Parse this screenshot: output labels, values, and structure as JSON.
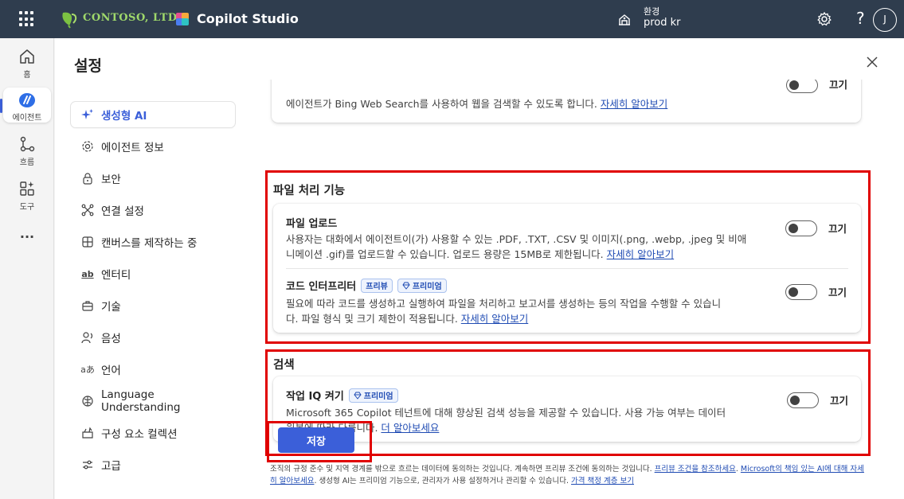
{
  "topbar": {
    "brand": "CONTOSO, LTD.",
    "app_title": "Copilot Studio",
    "env_label": "환경",
    "env_value": "prod kr",
    "avatar_initial": "J"
  },
  "rail": {
    "items": [
      {
        "label": "홈",
        "icon": "home-icon"
      },
      {
        "label": "에이전트",
        "icon": "agent-icon"
      },
      {
        "label": "흐름",
        "icon": "flow-icon"
      },
      {
        "label": "도구",
        "icon": "tools-icon"
      }
    ],
    "more": "···"
  },
  "panel": {
    "title": "설정"
  },
  "settings_nav": {
    "items": [
      {
        "label": "생성형 AI",
        "icon": "sparkle-icon"
      },
      {
        "label": "에이전트 정보",
        "icon": "gear-icon"
      },
      {
        "label": "보안",
        "icon": "lock-icon"
      },
      {
        "label": "연결 설정",
        "icon": "connection-icon"
      },
      {
        "label": "캔버스를 제작하는 중",
        "icon": "canvas-icon"
      },
      {
        "label": "엔터티",
        "icon": "entity-icon"
      },
      {
        "label": "기술",
        "icon": "briefcase-icon"
      },
      {
        "label": "음성",
        "icon": "voice-icon"
      },
      {
        "label": "언어",
        "icon": "language-icon"
      },
      {
        "label": "Language Understanding",
        "icon": "brain-icon"
      },
      {
        "label": "구성 요소 컬렉션",
        "icon": "collection-icon"
      },
      {
        "label": "고급",
        "icon": "sliders-icon"
      }
    ]
  },
  "content": {
    "top_card": {
      "desc": "에이전트가 Bing Web Search를 사용하여 웹을 검색할 수 있도록 합니다.",
      "link": "자세히 알아보기",
      "toggle_label": "끄기"
    },
    "file_section": {
      "heading": "파일 처리 기능",
      "upload": {
        "title": "파일 업로드",
        "desc_line1": "사용자는 대화에서 에이전트이(가) 사용할 수 있는 .PDF, .TXT, .CSV 및 이미지(.png, .webp, .jpeg 및 비애",
        "desc_line2": "니메이션 .gif)를 업로드할 수 있습니다. 업로드 용량은 15MB로 제한됩니다.",
        "link": "자세히 알아보기",
        "toggle_label": "끄기"
      },
      "interpreter": {
        "title": "코드 인터프리터",
        "badge_preview": "프리뷰",
        "badge_premium": "프리미엄",
        "desc_line1": "필요에 따라 코드를 생성하고 실행하여 파일을 처리하고 보고서를 생성하는 등의 작업을 수행할 수 있습니",
        "desc_line2": "다. 파일 형식 및 크기 제한이 적용됩니다.",
        "link": "자세히 알아보기",
        "toggle_label": "끄기"
      }
    },
    "search_section": {
      "heading": "검색",
      "work_iq": {
        "title": "작업 IQ 켜기",
        "badge_premium": "프리미엄",
        "desc_line1": "Microsoft 365 Copilot 테넌트에 대해 향상된 검색 성능을 제공할 수 있습니다. 사용 가능 여부는 데이터",
        "desc_line2": "원본에 따라 다릅니다.",
        "link": "더 알아보세요",
        "toggle_label": "끄기"
      }
    },
    "save_label": "저장",
    "footer": {
      "text1": "조직의 규정 준수 및 지역 경계를 밖으로 흐르는 데이터에 동의하는 것입니다. 계속하면 프리뷰 조건에 동의하는 것입니다.",
      "link1": "프리뷰 조건을 참조하세요",
      "link2": "Microsoft의 책임 있는 AI에 대해 자세히 알아보세요",
      "text2": "생성형 AI는 프리미엄 기능으로, 관리자가 사용 설정하거나 관리할 수 있습니다.",
      "link3": "가격 책정 계층 보기"
    }
  },
  "colors": {
    "topbar": "#2f3d4e",
    "accent": "#3b5fd9",
    "highlight": "#e00000",
    "link": "#1f4bb3"
  }
}
